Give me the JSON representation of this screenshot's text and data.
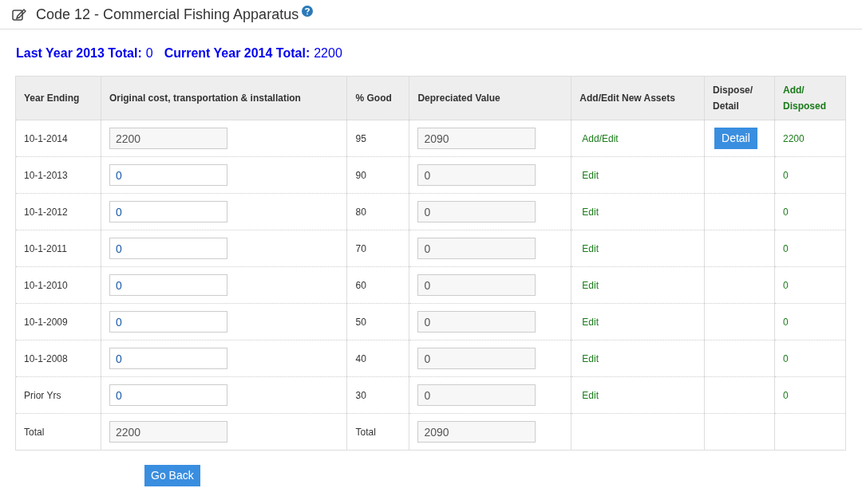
{
  "title": "Code 12 - Commercial Fishing Apparatus",
  "totals": [
    {
      "label": "Last Year 2013 Total:",
      "value": "0"
    },
    {
      "label": "Current Year 2014 Total:",
      "value": "2200"
    }
  ],
  "table": {
    "columns": [
      "Year Ending",
      "Original cost, transportation & installation",
      "% Good",
      "Depreciated Value",
      "Add/Edit New Assets",
      "Dispose/ Detail",
      "Add/ Disposed"
    ],
    "rows": [
      {
        "year": "10-1-2014",
        "cost": "2200",
        "cost_editable": false,
        "good": "95",
        "depreciated": "2090",
        "action": "Add/Edit",
        "detail": "Detail",
        "net": "2200"
      },
      {
        "year": "10-1-2013",
        "cost": "0",
        "cost_editable": true,
        "good": "90",
        "depreciated": "0",
        "action": "Edit",
        "net": "0"
      },
      {
        "year": "10-1-2012",
        "cost": "0",
        "cost_editable": true,
        "good": "80",
        "depreciated": "0",
        "action": "Edit",
        "net": "0"
      },
      {
        "year": "10-1-2011",
        "cost": "0",
        "cost_editable": true,
        "good": "70",
        "depreciated": "0",
        "action": "Edit",
        "net": "0"
      },
      {
        "year": "10-1-2010",
        "cost": "0",
        "cost_editable": true,
        "good": "60",
        "depreciated": "0",
        "action": "Edit",
        "net": "0"
      },
      {
        "year": "10-1-2009",
        "cost": "0",
        "cost_editable": true,
        "good": "50",
        "depreciated": "0",
        "action": "Edit",
        "net": "0"
      },
      {
        "year": "10-1-2008",
        "cost": "0",
        "cost_editable": true,
        "good": "40",
        "depreciated": "0",
        "action": "Edit",
        "net": "0"
      },
      {
        "year": "Prior Yrs",
        "cost": "0",
        "cost_editable": true,
        "good": "30",
        "depreciated": "0",
        "action": "Edit",
        "net": "0"
      }
    ],
    "total_row": {
      "label": "Total",
      "cost": "2200",
      "good_label": "Total",
      "depreciated": "2090"
    }
  },
  "back_button": "Go Back"
}
